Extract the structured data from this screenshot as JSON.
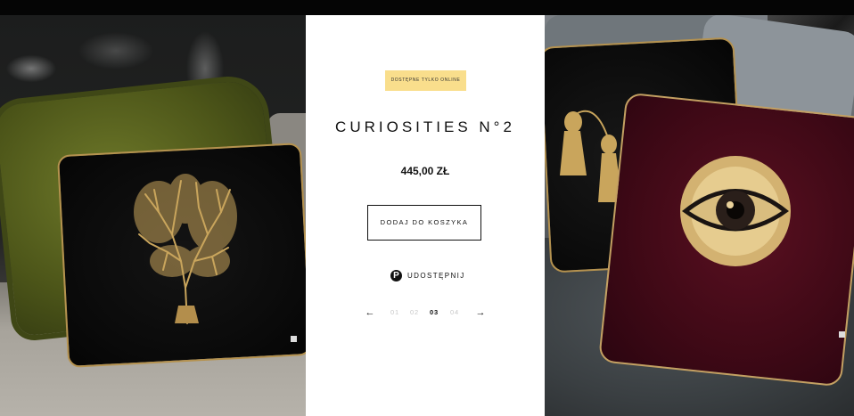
{
  "product": {
    "badge": "DOSTĘPNE TYLKO ONLINE",
    "title": "CURIOSITIES N°2",
    "price": "445,00 ZŁ",
    "add_to_cart_label": "DODAJ DO KOSZYKA",
    "share_label": "UDOSTĘPNIJ",
    "share_icon": "pinterest-icon"
  },
  "pager": {
    "prev_icon": "arrow-left-icon",
    "next_icon": "arrow-right-icon",
    "pages": [
      "01",
      "02",
      "03",
      "04"
    ],
    "current": "03"
  },
  "colors": {
    "badge_bg": "#f9de8c",
    "gold": "#b5924f",
    "burgundy": "#4a0c19",
    "olive": "#4d5619"
  }
}
